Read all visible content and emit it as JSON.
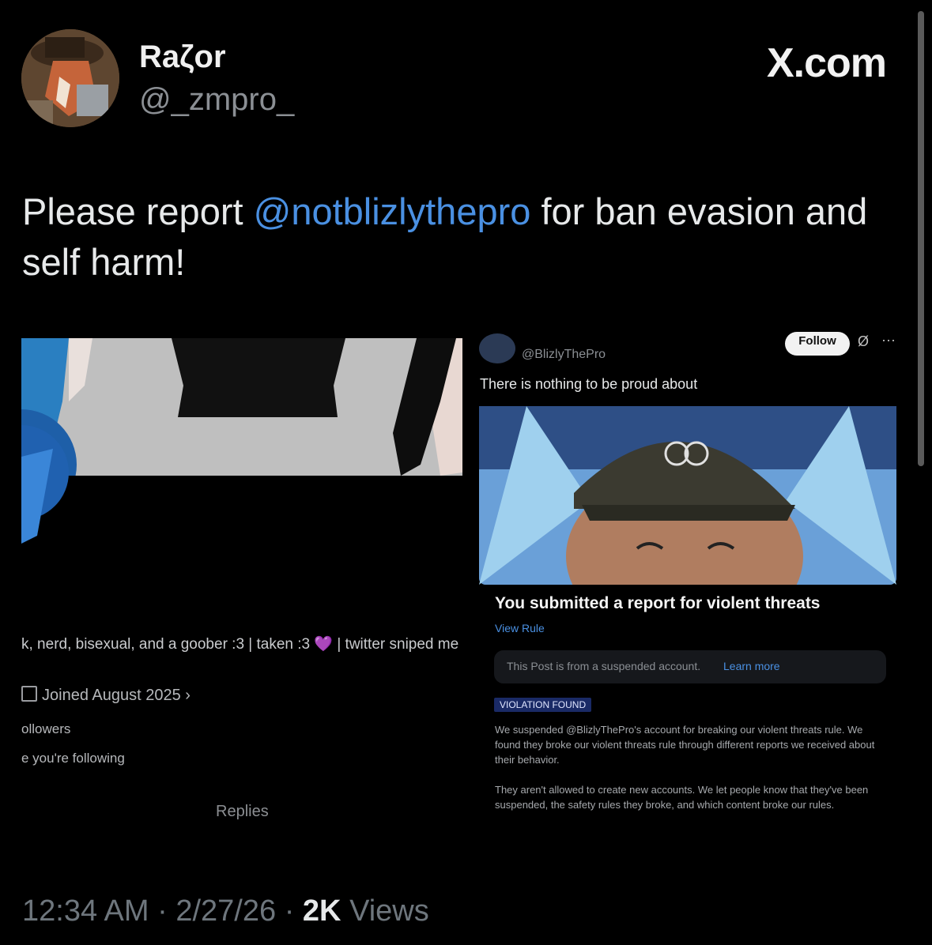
{
  "author": {
    "name": "Raζor",
    "handle": "@_zmpro_"
  },
  "brand": "X.com",
  "tweet": {
    "text_before": "Please report ",
    "mention": "@notblizlythepro",
    "text_after": " for ban evasion and self harm!"
  },
  "left_screenshot": {
    "bio": "k, nerd, bisexual, and a goober :3 | taken :3 💜 | twitter sniped me",
    "joined": "Joined August 2025",
    "followers": "ollowers",
    "following": "e you're following",
    "tab": "Replies"
  },
  "right_screenshot": {
    "handle": "@BlizlyThePro",
    "follow_label": "Follow",
    "post_text": "There is nothing to be proud about",
    "report_title": "You submitted a report for violent threats",
    "view_rule": "View Rule",
    "suspended_notice": "This Post is from a suspended account.",
    "learn_more": "Learn more",
    "violation_badge": "VIOLATION FOUND",
    "paragraph_1": "We suspended @BlizlyThePro's account for breaking our violent threats rule. We found they broke our violent threats rule through different reports we received about their behavior.",
    "paragraph_2": "They aren't allowed to create new accounts. We let people know that they've been suspended, the safety rules they broke, and which content broke our rules."
  },
  "footer": {
    "time": "12:34 AM",
    "date": "2/27/26",
    "views_count": "2K",
    "views_label": "Views"
  },
  "colors": {
    "link": "#4a90e2",
    "badge_bg": "#1a2a66"
  }
}
